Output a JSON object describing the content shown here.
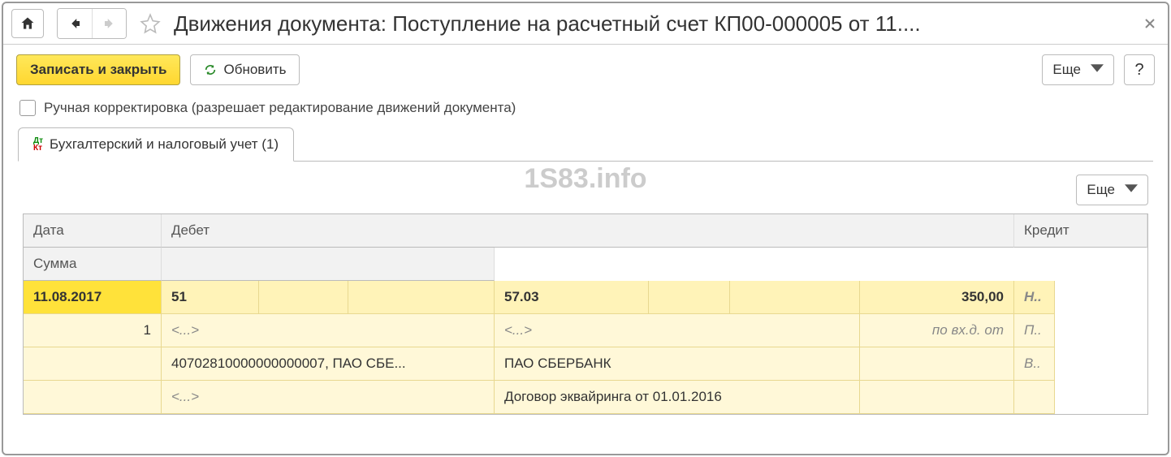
{
  "title": "Движения документа: Поступление на расчетный счет КП00-000005 от 11....",
  "toolbar": {
    "save_close": "Записать и закрыть",
    "refresh": "Обновить",
    "more": "Еще",
    "help": "?"
  },
  "checkbox_label": "Ручная корректировка (разрешает редактирование движений документа)",
  "tab_label": "Бухгалтерский и налоговый учет (1)",
  "watermark": "1S83.info",
  "grid": {
    "headers": {
      "date": "Дата",
      "debit": "Дебет",
      "credit": "Кредит",
      "sum": "Сумма"
    },
    "row1": {
      "date": "11.08.2017",
      "debit_account": "51",
      "credit_account": "57.03",
      "sum": "350,00",
      "note": "Н.."
    },
    "row2": {
      "seq": "1",
      "debit_sub1": "<...>",
      "credit_sub1": "<...>",
      "sum_note": "по вх.д.  от",
      "note": "П.."
    },
    "row3": {
      "debit_sub2": "40702810000000000007, ПАО СБЕ...",
      "credit_sub2": "ПАО СБЕРБАНК",
      "note": "В.."
    },
    "row4": {
      "debit_sub3": "<...>",
      "credit_sub3": "Договор эквайринга от 01.01.2016"
    }
  }
}
